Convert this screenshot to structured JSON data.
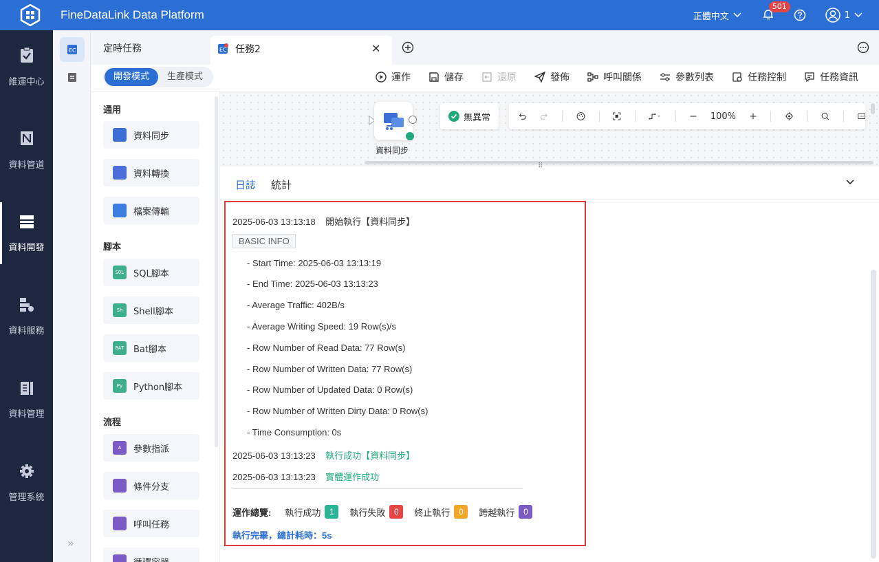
{
  "app": {
    "title": "FineDataLink Data Platform"
  },
  "topbar": {
    "language": "正體中文",
    "notification_count": "501",
    "user": "1"
  },
  "leftnav": [
    {
      "label": "維運中心",
      "icon": "clipboard-check-icon"
    },
    {
      "label": "資料管道",
      "icon": "pipeline-icon"
    },
    {
      "label": "資料開發",
      "icon": "dev-icon",
      "active": true
    },
    {
      "label": "資料服務",
      "icon": "service-icon"
    },
    {
      "label": "資料管理",
      "icon": "manage-icon"
    },
    {
      "label": "管理系統",
      "icon": "gear-icon"
    }
  ],
  "tabs": {
    "scheduled": "定時任務",
    "task": "任務2"
  },
  "mode": {
    "dev": "開發模式",
    "prod": "生產模式"
  },
  "toolbar": {
    "run": "運作",
    "save": "儲存",
    "restore": "還原",
    "publish": "發佈",
    "call_relation": "呼叫關係",
    "params": "參數列表",
    "task_control": "任務控制",
    "task_info": "任務資訊"
  },
  "palette": {
    "general_title": "通用",
    "general": [
      "資料同步",
      "資料轉換",
      "檔案傳輸"
    ],
    "script_title": "腳本",
    "scripts": [
      "SQL腳本",
      "Shell腳本",
      "Bat腳本",
      "Python腳本"
    ],
    "flow_title": "流程",
    "flow": [
      "參數指派",
      "條件分支",
      "呼叫任務",
      "循環容器"
    ]
  },
  "canvas": {
    "node_label": "資料同步",
    "status": "無異常",
    "zoom": "100%"
  },
  "log": {
    "tab_log": "日誌",
    "tab_stats": "統計",
    "start_line_time": "2025-06-03 13:13:18",
    "start_line_text": "開始執行【資料同步】",
    "basic_info": "BASIC INFO",
    "details": [
      "- Start Time: 2025-06-03 13:13:19",
      "- End Time: 2025-06-03 13:13:23",
      "- Average Traffic: 402B/s",
      "- Average Writing Speed: 19 Row(s)/s",
      "- Row Number of Read Data: 77 Row(s)",
      "- Row Number of Written Data: 77 Row(s)",
      "- Row Number of Updated Data: 0 Row(s)",
      "- Row Number of Written Dirty Data: 0 Row(s)",
      "- Time Consumption: 0s"
    ],
    "success_time": "2025-06-03 13:13:23",
    "success_text": "執行成功【資料同步】",
    "entity_time": "2025-06-03 13:13:23",
    "entity_text": "實體運作成功",
    "summary_label": "運作總覽:",
    "summary": [
      {
        "label": "執行成功",
        "count": "1",
        "color": "#2bb596"
      },
      {
        "label": "執行失敗",
        "count": "0",
        "color": "#e54545"
      },
      {
        "label": "終止執行",
        "count": "0",
        "color": "#f0a629"
      },
      {
        "label": "跨越執行",
        "count": "0",
        "color": "#7b5cc4"
      }
    ],
    "done": "執行完畢，總計耗時：5s"
  }
}
